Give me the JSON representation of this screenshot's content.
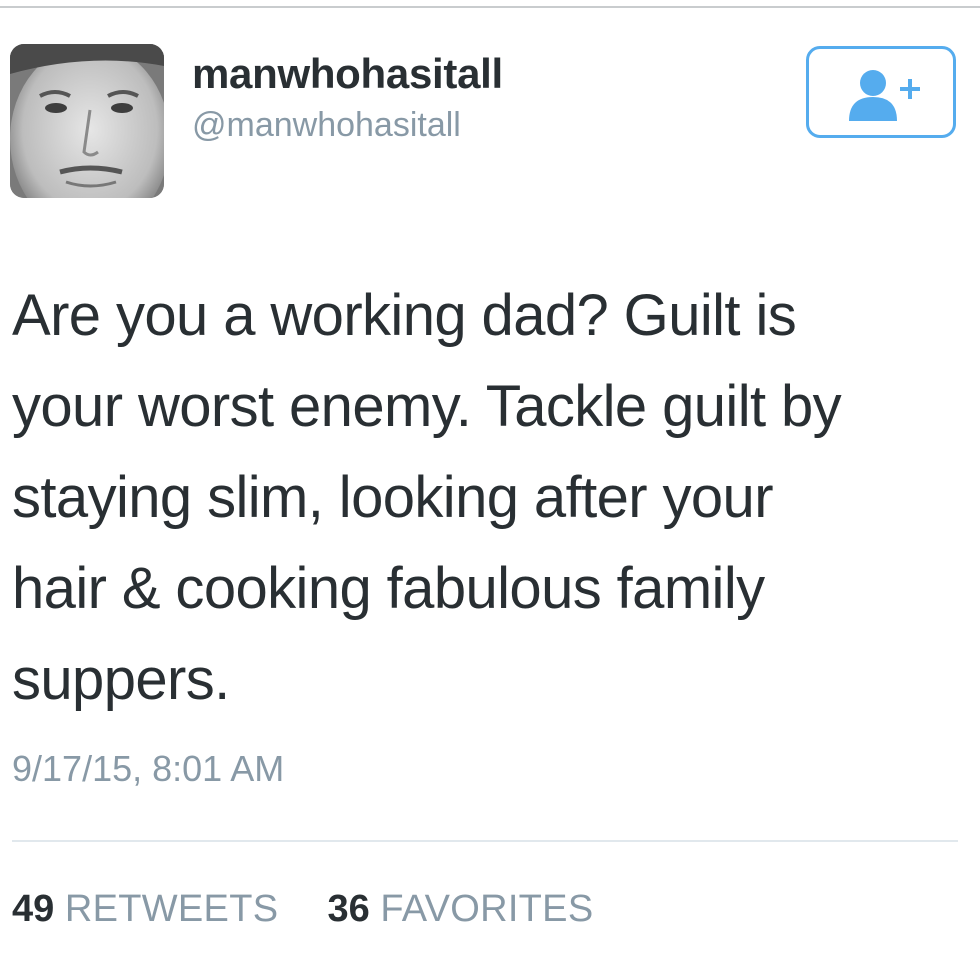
{
  "user": {
    "display_name": "manwhohasitall",
    "handle": "@manwhohasitall",
    "avatar_icon": "profile-photo"
  },
  "follow_button": {
    "icon": "add-user-icon",
    "accent_color": "#55acee"
  },
  "tweet": {
    "lines": [
      "Are you a working dad? Guilt is",
      "your worst enemy. Tackle guilt by",
      "staying slim, looking after your",
      "hair & cooking fabulous family",
      "suppers."
    ],
    "timestamp": "9/17/15, 8:01 AM"
  },
  "stats": {
    "retweets_count": "49",
    "retweets_label": "RETWEETS",
    "favorites_count": "36",
    "favorites_label": "FAVORITES"
  }
}
